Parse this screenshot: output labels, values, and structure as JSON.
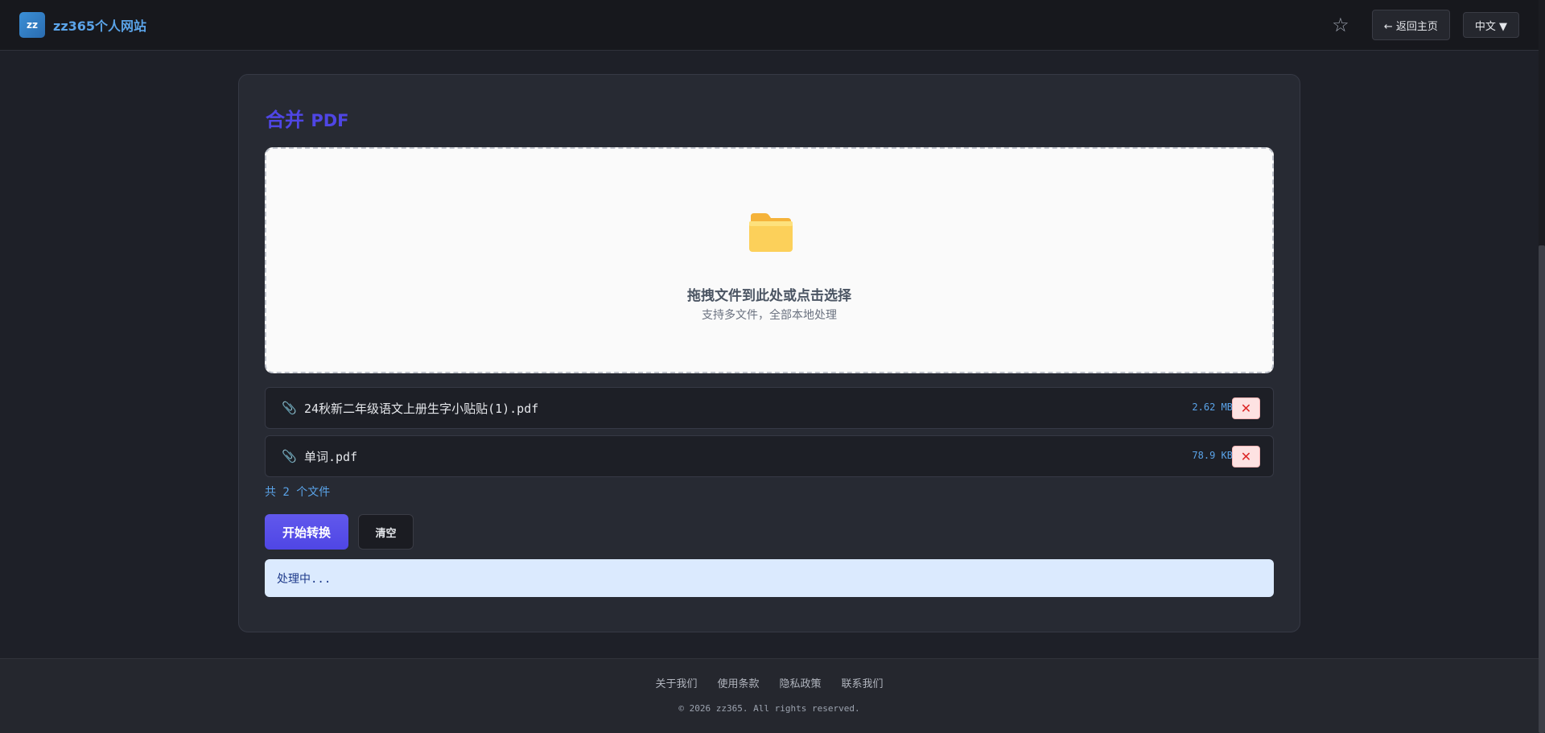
{
  "header": {
    "logo_text": "zz",
    "site_name": "zz365个人网站",
    "favorite_icon": "☆",
    "back_button": "← 返回主页",
    "language": "中文 ▼"
  },
  "tool": {
    "title_cn": "合并",
    "title_pdf": "PDF",
    "dropzone": {
      "icon": "folder-icon",
      "main_text": "拖拽文件到此处或点击选择",
      "sub_text": "支持多文件，全部本地处理"
    },
    "files": [
      {
        "icon": "📎",
        "name": "24秋新二年级语文上册生字小贴贴(1).pdf",
        "size": "2.62 MB",
        "remove": "✕"
      },
      {
        "icon": "📎",
        "name": "单词.pdf",
        "size": "78.9 KB",
        "remove": "✕"
      }
    ],
    "count_text": "共 2 个文件",
    "start_button": "开始转换",
    "clear_button": "清空",
    "status_text": "处理中..."
  },
  "footer": {
    "links": [
      "关于我们",
      "使用条款",
      "隐私政策",
      "联系我们"
    ],
    "copyright": "© 2026 zz365. All rights reserved."
  },
  "colors": {
    "accent": "#4f46e5",
    "link": "#5aa3e8",
    "status_bg": "#dbeafe"
  }
}
